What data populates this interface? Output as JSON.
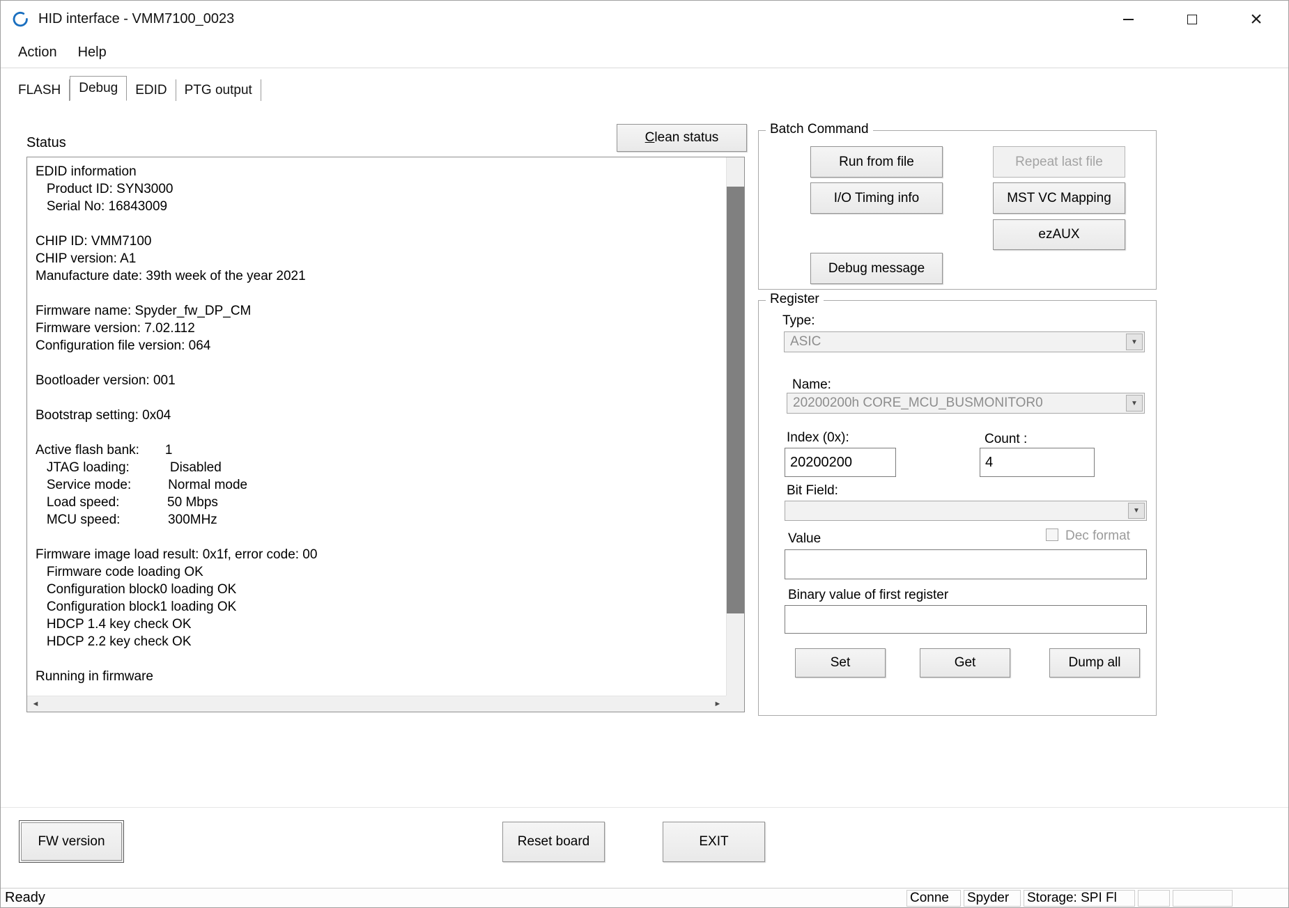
{
  "window": {
    "title": "HID interface - VMM7100_0023"
  },
  "menu": {
    "items": [
      {
        "label": "Action"
      },
      {
        "label": "Help"
      }
    ]
  },
  "tabs": [
    {
      "label": "FLASH"
    },
    {
      "label": "Debug"
    },
    {
      "label": "EDID"
    },
    {
      "label": "PTG output"
    }
  ],
  "icons": {
    "app_logo": "blue-drop-logo",
    "dropdown_arrow": "▼",
    "scroll_left": "◄",
    "scroll_right": "►",
    "close": "×"
  },
  "colors": {
    "logo_blue": "#1a6fbf",
    "scroll_thumb": "#808080",
    "disabled_text": "#a3a3a3"
  },
  "status_panel": {
    "label": "Status",
    "clean_button": "Clean status",
    "lines": [
      "EDID information",
      "   Product ID: SYN3000",
      "   Serial No: 16843009",
      "",
      "CHIP ID: VMM7100",
      "CHIP version: A1",
      "Manufacture date: 39th week of the year 2021",
      "",
      "Firmware name: Spyder_fw_DP_CM",
      "Firmware version: 7.02.112",
      "Configuration file version: 064",
      "",
      "Bootloader version: 001",
      "",
      "Bootstrap setting: 0x04",
      "",
      "Active flash bank:       1",
      "   JTAG loading:           Disabled",
      "   Service mode:          Normal mode",
      "   Load speed:             50 Mbps",
      "   MCU speed:             300MHz",
      "",
      "Firmware image load result: 0x1f, error code: 00",
      "   Firmware code loading OK",
      "   Configuration block0 loading OK",
      "   Configuration block1 loading OK",
      "   HDCP 1.4 key check OK",
      "   HDCP 2.2 key check OK",
      "",
      "Running in firmware"
    ]
  },
  "batch_command": {
    "title": "Batch Command",
    "buttons": {
      "run_from_file": "Run from file",
      "repeat_last_file": "Repeat last file",
      "io_timing_info": "I/O Timing info",
      "mst_vc_mapping": "MST VC Mapping",
      "ezaux": "ezAUX",
      "debug_message": "Debug message"
    }
  },
  "register": {
    "title": "Register",
    "type_label": "Type:",
    "type_value": "ASIC",
    "name_label": "Name:",
    "name_value": "20200200h CORE_MCU_BUSMONITOR0",
    "index_label": "Index (0x):",
    "index_value": "20200200",
    "count_label": "Count :",
    "count_value": "4",
    "bitfield_label": "Bit Field:",
    "bitfield_value": "",
    "value_label": "Value",
    "dec_format_label": "Dec format",
    "value_value": "",
    "binary_label": "Binary value of first register",
    "binary_value": "",
    "buttons": {
      "set": "Set",
      "get": "Get",
      "dump_all": "Dump all"
    }
  },
  "footer": {
    "fw_version": "FW version",
    "reset_board": "Reset board",
    "exit": "EXIT"
  },
  "statusbar": {
    "ready": "Ready",
    "segments": [
      "Conne",
      "Spyder",
      "Storage: SPI Fl",
      "",
      ""
    ]
  }
}
